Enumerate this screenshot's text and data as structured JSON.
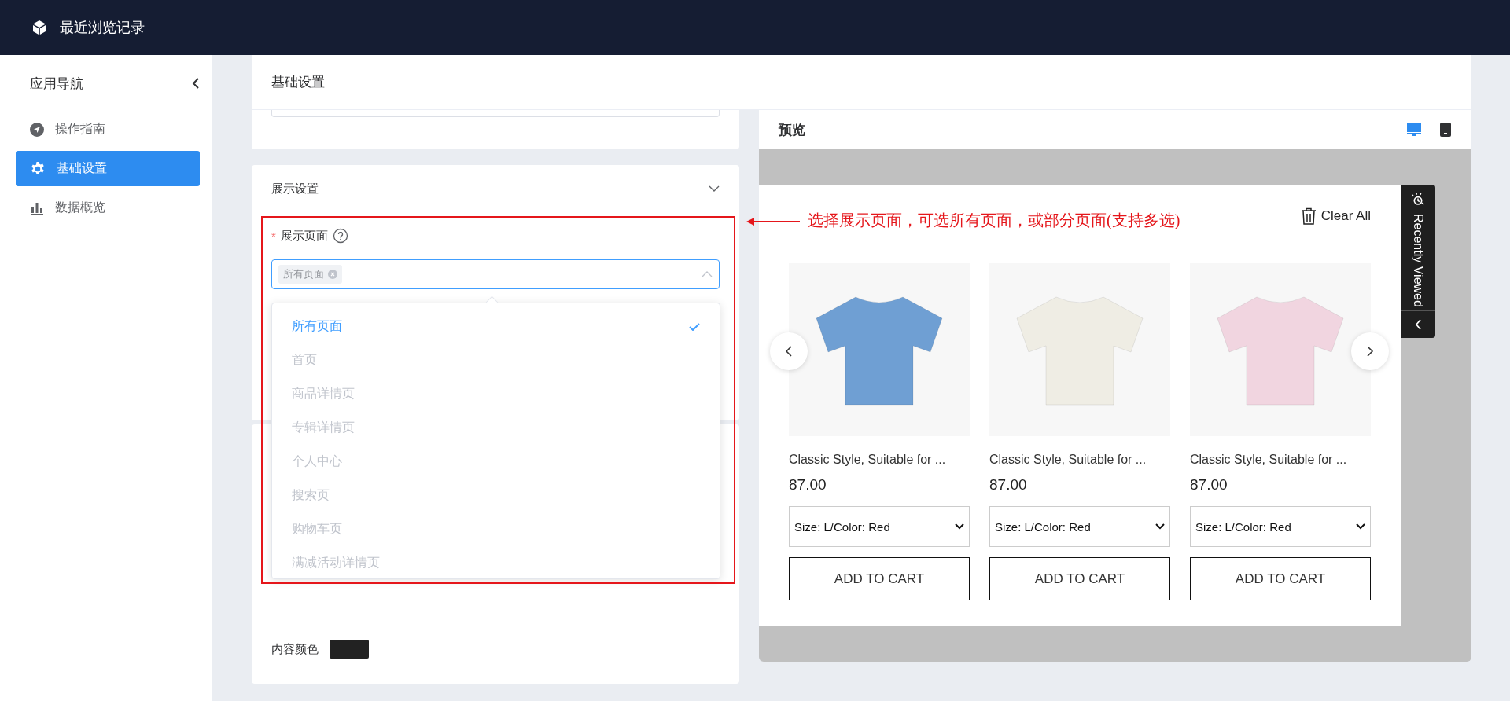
{
  "header": {
    "title": "最近浏览记录"
  },
  "sidebar": {
    "title": "应用导航",
    "items": [
      {
        "label": "操作指南",
        "selected": false
      },
      {
        "label": "基础设置",
        "selected": true
      },
      {
        "label": "数据概览",
        "selected": false
      }
    ]
  },
  "page_title": "基础设置",
  "display_settings": {
    "title": "展示设置",
    "field": {
      "required_mark": "*",
      "label": "展示页面",
      "tags": [
        "所有页面"
      ]
    },
    "options": [
      {
        "label": "所有页面",
        "selected": true,
        "disabled": false
      },
      {
        "label": "首页",
        "selected": false,
        "disabled": true
      },
      {
        "label": "商品详情页",
        "selected": false,
        "disabled": true
      },
      {
        "label": "专辑详情页",
        "selected": false,
        "disabled": true
      },
      {
        "label": "个人中心",
        "selected": false,
        "disabled": true
      },
      {
        "label": "搜索页",
        "selected": false,
        "disabled": true
      },
      {
        "label": "购物车页",
        "selected": false,
        "disabled": true
      },
      {
        "label": "满减活动详情页",
        "selected": false,
        "disabled": true
      }
    ]
  },
  "content_color": {
    "label": "内容颜色",
    "color": "#222222"
  },
  "annotation": {
    "text": "选择展示页面，可选所有页面，或部分页面(支持多选)"
  },
  "preview": {
    "title": "预览",
    "modes": [
      {
        "kind": "desktop",
        "selected": true
      },
      {
        "kind": "mobile",
        "selected": false
      }
    ],
    "clear_all": "Clear All",
    "tab_label": "Recently Viewed",
    "products": [
      {
        "title": "Classic Style, Suitable for ...",
        "price": "87.00",
        "variant": "Size: L/Color: Red",
        "button": "ADD TO CART",
        "color": "#6f9fd3"
      },
      {
        "title": "Classic Style, Suitable for ...",
        "price": "87.00",
        "variant": "Size: L/Color: Red",
        "button": "ADD TO CART",
        "color": "#efede4"
      },
      {
        "title": "Classic Style, Suitable for ...",
        "price": "87.00",
        "variant": "Size: L/Color: Red",
        "button": "ADD TO CART",
        "color": "#f1d5e0"
      }
    ]
  }
}
